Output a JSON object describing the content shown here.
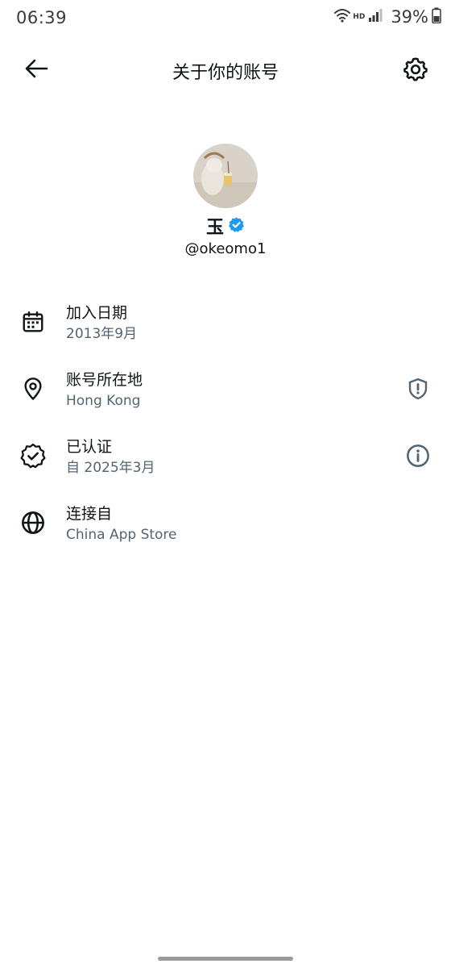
{
  "status_bar": {
    "time": "06:39",
    "network_label": "HD",
    "battery": "39%"
  },
  "header": {
    "title": "关于你的账号",
    "back_icon": "arrow-left-icon",
    "settings_icon": "gear-icon"
  },
  "profile": {
    "name": "玉",
    "handle": "@okeomo1",
    "verified": true,
    "verified_color": "#1d9bf0"
  },
  "rows": [
    {
      "icon": "calendar-icon",
      "title": "加入日期",
      "subtitle": "2013年9月"
    },
    {
      "icon": "location-pin-icon",
      "title": "账号所在地",
      "subtitle": "Hong Kong",
      "action_icon": "shield-alert-icon"
    },
    {
      "icon": "verified-badge-icon",
      "title": "已认证",
      "subtitle": "自 2025年3月",
      "action_icon": "info-icon"
    },
    {
      "icon": "globe-icon",
      "title": "连接自",
      "subtitle": "China App Store"
    }
  ],
  "colors": {
    "text_primary": "#0f1419",
    "text_secondary": "#536471",
    "background": "#ffffff"
  }
}
